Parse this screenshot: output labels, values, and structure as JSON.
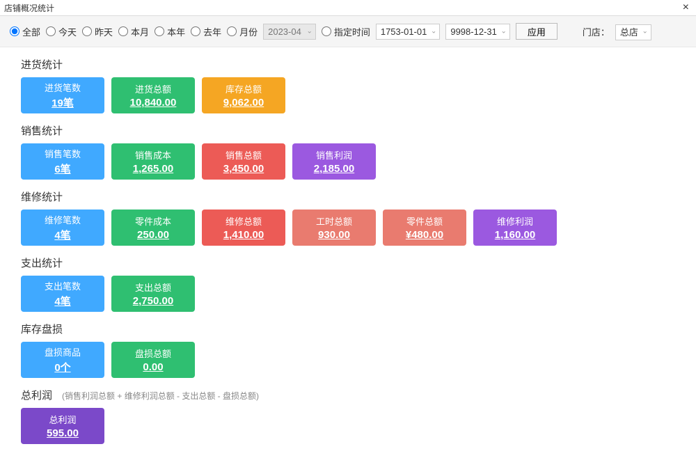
{
  "window": {
    "title": "店铺概况统计",
    "close": "×"
  },
  "filter": {
    "radios": [
      "全部",
      "今天",
      "昨天",
      "本月",
      "本年",
      "去年",
      "月份"
    ],
    "selected": 0,
    "month_value": "2023-04",
    "custom_label": "指定时间",
    "date_from": "1753-01-01",
    "date_to": "9998-12-31",
    "apply": "应用",
    "store_label": "门店：",
    "store_value": "总店"
  },
  "sections": {
    "purchase": {
      "title": "进货统计",
      "cards": [
        {
          "label": "进货笔数",
          "value": "19笔",
          "color": "blue"
        },
        {
          "label": "进货总额",
          "value": "10,840.00",
          "color": "green"
        },
        {
          "label": "库存总额",
          "value": "9,062.00",
          "color": "orange"
        }
      ]
    },
    "sales": {
      "title": "销售统计",
      "cards": [
        {
          "label": "销售笔数",
          "value": "6笔",
          "color": "blue"
        },
        {
          "label": "销售成本",
          "value": "1,265.00",
          "color": "green"
        },
        {
          "label": "销售总额",
          "value": "3,450.00",
          "color": "red"
        },
        {
          "label": "销售利润",
          "value": "2,185.00",
          "color": "purple"
        }
      ]
    },
    "repair": {
      "title": "维修统计",
      "cards": [
        {
          "label": "维修笔数",
          "value": "4笔",
          "color": "blue"
        },
        {
          "label": "零件成本",
          "value": "250.00",
          "color": "green"
        },
        {
          "label": "维修总额",
          "value": "1,410.00",
          "color": "red"
        },
        {
          "label": "工时总额",
          "value": "930.00",
          "color": "coral"
        },
        {
          "label": "零件总额",
          "value": "¥480.00",
          "color": "coral"
        },
        {
          "label": "维修利润",
          "value": "1,160.00",
          "color": "purple"
        }
      ]
    },
    "expense": {
      "title": "支出统计",
      "cards": [
        {
          "label": "支出笔数",
          "value": "4笔",
          "color": "blue"
        },
        {
          "label": "支出总额",
          "value": "2,750.00",
          "color": "green"
        }
      ]
    },
    "loss": {
      "title": "库存盘损",
      "cards": [
        {
          "label": "盘损商品",
          "value": "0个",
          "color": "blue"
        },
        {
          "label": "盘损总额",
          "value": "0.00",
          "color": "green"
        }
      ]
    },
    "profit": {
      "title": "总利润",
      "note": "(销售利润总额 + 维修利润总额 - 支出总额 - 盘损总额)",
      "cards": [
        {
          "label": "总利润",
          "value": "595.00",
          "color": "violet"
        }
      ]
    }
  }
}
